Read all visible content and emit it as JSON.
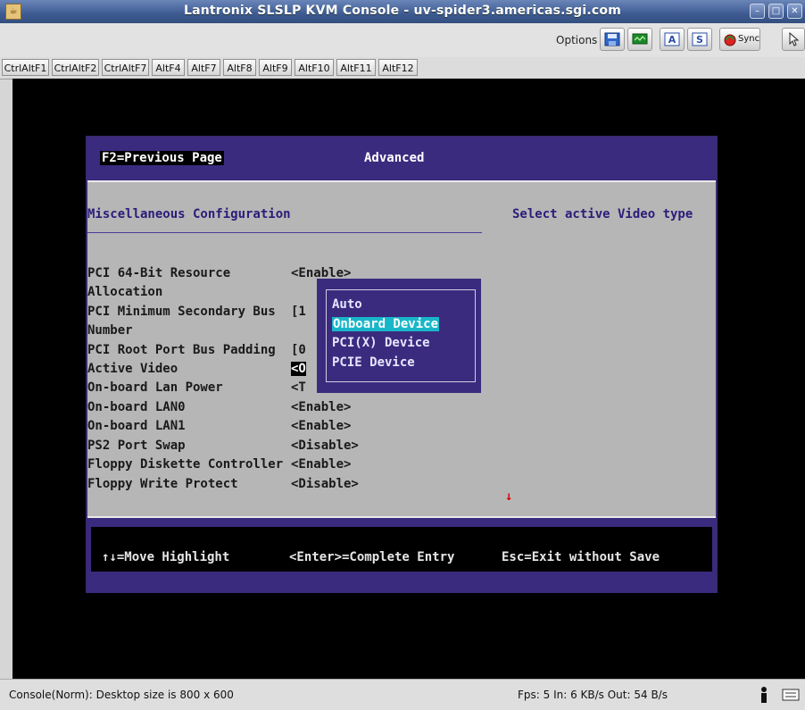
{
  "window": {
    "title": "Lantronix SLSLP KVM Console - uv-spider3.americas.sgi.com",
    "controls": [
      "minimize-icon",
      "maximize-icon",
      "close-icon"
    ]
  },
  "options_bar": {
    "label": "Options",
    "buttons": [
      "save-icon",
      "monitor-icon",
      "text-a-icon",
      "text-s-icon",
      "sync-icon",
      "pointer-icon"
    ],
    "sync_label": "Sync"
  },
  "function_keys": [
    "CtrlAltF1",
    "CtrlAltF2",
    "CtrlAltF7",
    "AltF4",
    "AltF7",
    "AltF8",
    "AltF9",
    "AltF10",
    "AltF11",
    "AltF12"
  ],
  "bios": {
    "header_left": "F2=Previous Page",
    "header_title": "Advanced",
    "section_title": "Miscellaneous Configuration",
    "help_text": "Select active Video type",
    "settings": [
      {
        "label": "PCI 64-Bit Resource",
        "value": "<Enable>"
      },
      {
        "label": "Allocation",
        "value": ""
      },
      {
        "label": "PCI Minimum Secondary Bus",
        "value": "[1"
      },
      {
        "label": "Number",
        "value": ""
      },
      {
        "label": "PCI Root Port Bus Padding",
        "value": "[0"
      },
      {
        "label": "Active Video",
        "value": "<O"
      },
      {
        "label": "On-board Lan Power",
        "value": "<T"
      },
      {
        "label": "On-board LAN0",
        "value": "<Enable>"
      },
      {
        "label": "On-board LAN1",
        "value": "<Enable>"
      },
      {
        "label": "PS2 Port Swap",
        "value": "<Disable>"
      },
      {
        "label": "Floppy Diskette Controller",
        "value": "<Enable>"
      },
      {
        "label": "Floppy Write Protect",
        "value": "<Disable>"
      }
    ],
    "popup_options": [
      "Auto",
      "Onboard Device",
      "PCI(X) Device",
      "PCIE Device"
    ],
    "popup_selected": "Onboard Device",
    "scroll_indicator": "↓",
    "footer": {
      "move": "↑↓=Move Highlight",
      "enter": "<Enter>=Complete Entry",
      "esc": "Esc=Exit without Save"
    }
  },
  "status_bar": {
    "left": "Console(Norm): Desktop size is 800 x 600",
    "stats": "Fps: 5 In: 6 KB/s Out: 54 B/s"
  }
}
